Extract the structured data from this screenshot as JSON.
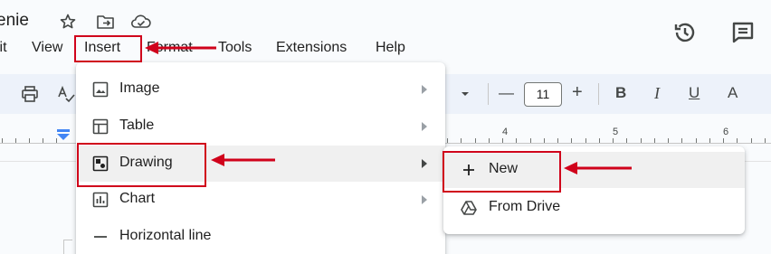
{
  "title_bar": {
    "doc_title": "enie",
    "icons": [
      "star-icon",
      "move-to-folder-icon",
      "cloud-status-icon"
    ]
  },
  "right_icons": [
    "version-history-icon",
    "comments-icon"
  ],
  "menubar": {
    "items": [
      {
        "label": "lit"
      },
      {
        "label": "View"
      },
      {
        "label": "Insert"
      },
      {
        "label": "Format"
      },
      {
        "label": "Tools"
      },
      {
        "label": "Extensions"
      },
      {
        "label": "Help"
      }
    ]
  },
  "toolbar": {
    "font_size": "11",
    "minus": "—",
    "plus": "+",
    "bold": "B",
    "italic": "I",
    "underline": "U",
    "text_color": "A"
  },
  "ruler": {
    "numbers": [
      "4",
      "5",
      "6"
    ]
  },
  "insert_menu": {
    "items": [
      {
        "label": "Image",
        "icon": "image-icon",
        "has_submenu": true
      },
      {
        "label": "Table",
        "icon": "table-icon",
        "has_submenu": true
      },
      {
        "label": "Drawing",
        "icon": "drawing-icon",
        "has_submenu": true
      },
      {
        "label": "Chart",
        "icon": "chart-icon",
        "has_submenu": true
      },
      {
        "label": "Horizontal line",
        "icon": "horizontal-line-icon",
        "has_submenu": false
      }
    ]
  },
  "drawing_submenu": {
    "items": [
      {
        "label": "New",
        "icon": "plus-icon"
      },
      {
        "label": "From Drive",
        "icon": "drive-icon"
      }
    ]
  },
  "annotation_color": "#d0021b"
}
